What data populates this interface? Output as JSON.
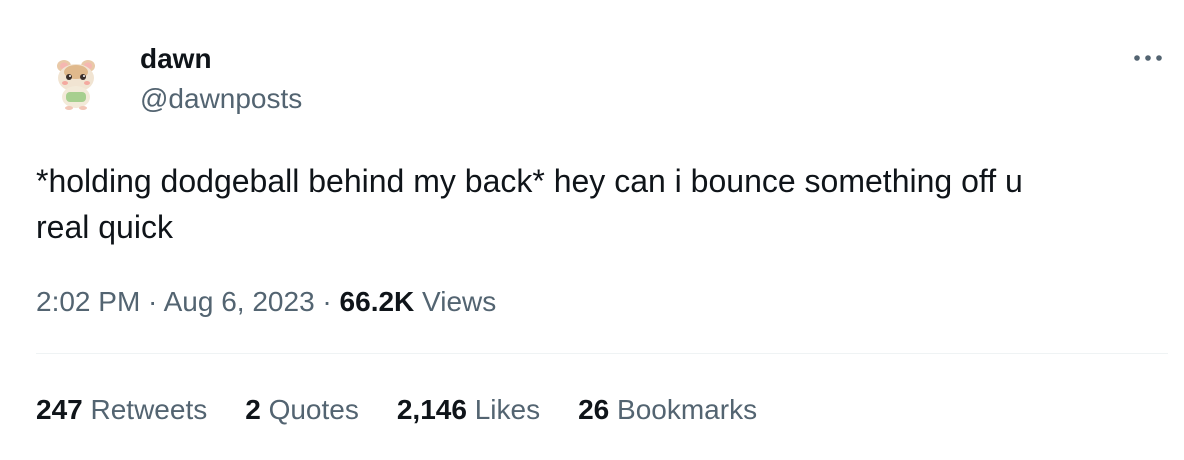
{
  "author": {
    "display_name": "dawn",
    "handle": "@dawnposts",
    "avatar_icon": "hamster-avatar-icon"
  },
  "more_icon": "more-horizontal-icon",
  "tweet": {
    "text": "*holding dodgeball behind my back* hey can i bounce something off u\nreal quick"
  },
  "meta": {
    "time": "2:02 PM",
    "separator": " · ",
    "date": "Aug 6, 2023",
    "views_count": "66.2K",
    "views_label": "Views"
  },
  "stats": {
    "retweets": {
      "count": "247",
      "label": "Retweets"
    },
    "quotes": {
      "count": "2",
      "label": "Quotes"
    },
    "likes": {
      "count": "2,146",
      "label": "Likes"
    },
    "bookmarks": {
      "count": "26",
      "label": "Bookmarks"
    }
  },
  "colors": {
    "primary_text": "#0f1419",
    "secondary_text": "#536471",
    "divider": "#eff3f4",
    "background": "#ffffff"
  }
}
